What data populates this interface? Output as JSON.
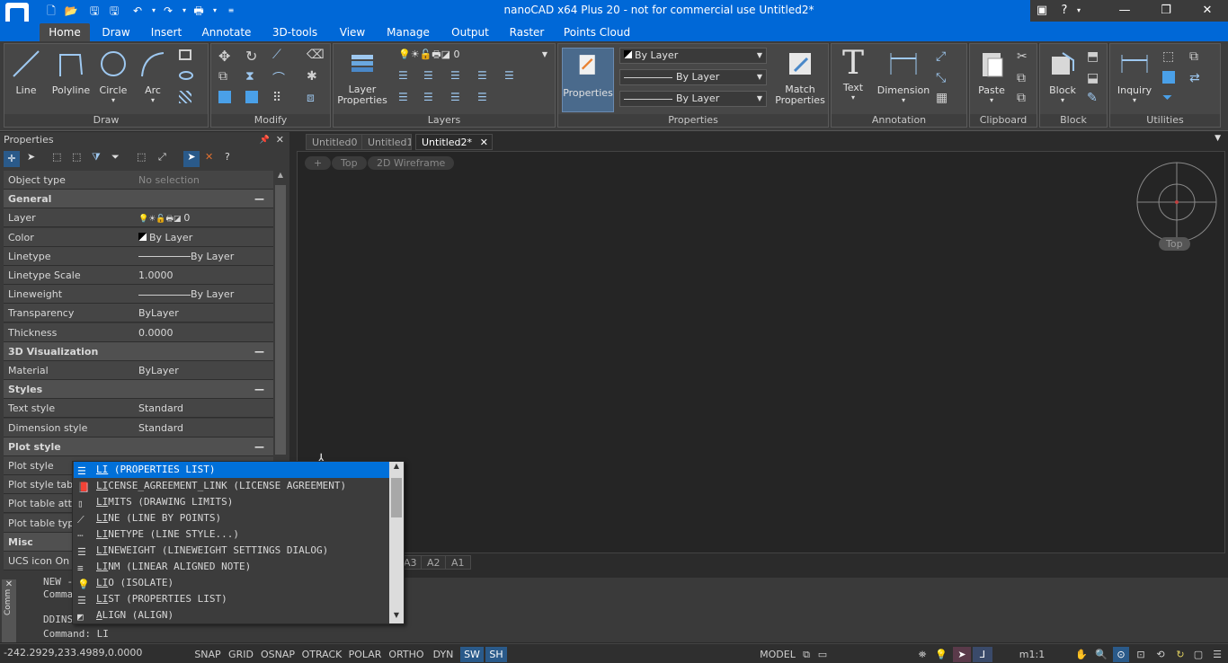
{
  "window": {
    "title": "nanoCAD x64 Plus 20 - not for commercial use Untitled2*"
  },
  "ribbon_tabs": [
    "Home",
    "Draw",
    "Insert",
    "Annotate",
    "3D-tools",
    "View",
    "Manage",
    "Output",
    "Raster",
    "Points Cloud"
  ],
  "panels": {
    "draw": {
      "label": "Draw",
      "buttons": [
        "Line",
        "Polyline",
        "Circle",
        "Arc"
      ]
    },
    "modify": {
      "label": "Modify"
    },
    "layers": {
      "label": "Layers",
      "buttons": [
        "Layer Properties"
      ],
      "layer_value": "0"
    },
    "properties": {
      "label": "Properties",
      "buttons": [
        "Properties",
        "Match Properties"
      ],
      "color": "By Layer",
      "linetype": "By Layer",
      "lineweight": "By Layer"
    },
    "annotation": {
      "label": "Annotation",
      "buttons": [
        "Text",
        "Dimension"
      ]
    },
    "clipboard": {
      "label": "Clipboard",
      "buttons": [
        "Paste"
      ]
    },
    "block": {
      "label": "Block",
      "buttons": [
        "Block"
      ]
    },
    "utilities": {
      "label": "Utilities",
      "buttons": [
        "Inquiry"
      ]
    }
  },
  "properties_palette": {
    "title": "Properties",
    "rows": [
      {
        "key": "Object type",
        "value": "No selection",
        "section": false
      },
      {
        "key": "General",
        "value": "",
        "section": true
      },
      {
        "key": "Layer",
        "value": "0",
        "section": false
      },
      {
        "key": "Color",
        "value": "By Layer",
        "section": false
      },
      {
        "key": "Linetype",
        "value": "By Layer",
        "section": false
      },
      {
        "key": "Linetype Scale",
        "value": "1.0000",
        "section": false
      },
      {
        "key": "Lineweight",
        "value": "By Layer",
        "section": false
      },
      {
        "key": "Transparency",
        "value": "ByLayer",
        "section": false
      },
      {
        "key": "Thickness",
        "value": "0.0000",
        "section": false
      },
      {
        "key": "3D Visualization",
        "value": "",
        "section": true
      },
      {
        "key": "Material",
        "value": "ByLayer",
        "section": false
      },
      {
        "key": "Styles",
        "value": "",
        "section": true
      },
      {
        "key": "Text style",
        "value": "Standard",
        "section": false
      },
      {
        "key": "Dimension style",
        "value": "Standard",
        "section": false
      },
      {
        "key": "Plot style",
        "value": "",
        "section": true
      },
      {
        "key": "Plot style",
        "value": "",
        "section": false
      },
      {
        "key": "Plot style table",
        "value": "",
        "section": false
      },
      {
        "key": "Plot table attac",
        "value": "",
        "section": false
      },
      {
        "key": "Plot table type",
        "value": "",
        "section": false
      },
      {
        "key": "Misc",
        "value": "",
        "section": true
      },
      {
        "key": "UCS icon On",
        "value": "",
        "section": false
      }
    ]
  },
  "doc_tabs": [
    "Untitled0",
    "Untitled1",
    "Untitled2*"
  ],
  "viewport": {
    "pills": [
      "+",
      "Top",
      "2D Wireframe"
    ],
    "viewcube_label": "Top"
  },
  "layout_tabs": [
    "A3",
    "A2",
    "A1"
  ],
  "command_line": {
    "lines": [
      "NEW - New",
      "Command:",
      "",
      "DDINSERT"
    ],
    "prompt": "Command: LI",
    "side_label": "Comm"
  },
  "autocomplete": {
    "items": [
      {
        "typed": "LI",
        "rest": " (PROPERTIES LIST)"
      },
      {
        "typed": "LI",
        "rest": "CENSE_AGREEMENT_LINK (LICENSE AGREEMENT)"
      },
      {
        "typed": "LI",
        "rest": "MITS (DRAWING LIMITS)"
      },
      {
        "typed": "LI",
        "rest": "NE (LINE BY POINTS)"
      },
      {
        "typed": "LI",
        "rest": "NETYPE (LINE STYLE...)"
      },
      {
        "typed": "LI",
        "rest": "NEWEIGHT (LINEWEIGHT SETTINGS DIALOG)"
      },
      {
        "typed": "LI",
        "rest": "NM (LINEAR ALIGNED NOTE)"
      },
      {
        "typed": "LI",
        "rest": "O (ISOLATE)"
      },
      {
        "typed": "LI",
        "rest": "ST (PROPERTIES LIST)"
      },
      {
        "typed": "A",
        "rest": "LIGN (ALIGN)"
      }
    ]
  },
  "status": {
    "coords": "-242.2929,233.4989,0.0000",
    "toggles": [
      "SNAP",
      "GRID",
      "OSNAP",
      "OTRACK",
      "POLAR",
      "ORTHO",
      "DYN",
      "SW",
      "SH"
    ],
    "model": "MODEL",
    "scale": "m1:1"
  },
  "colors": {
    "accent": "#0068d7",
    "selection": "#0070d9",
    "background": "#252525"
  }
}
